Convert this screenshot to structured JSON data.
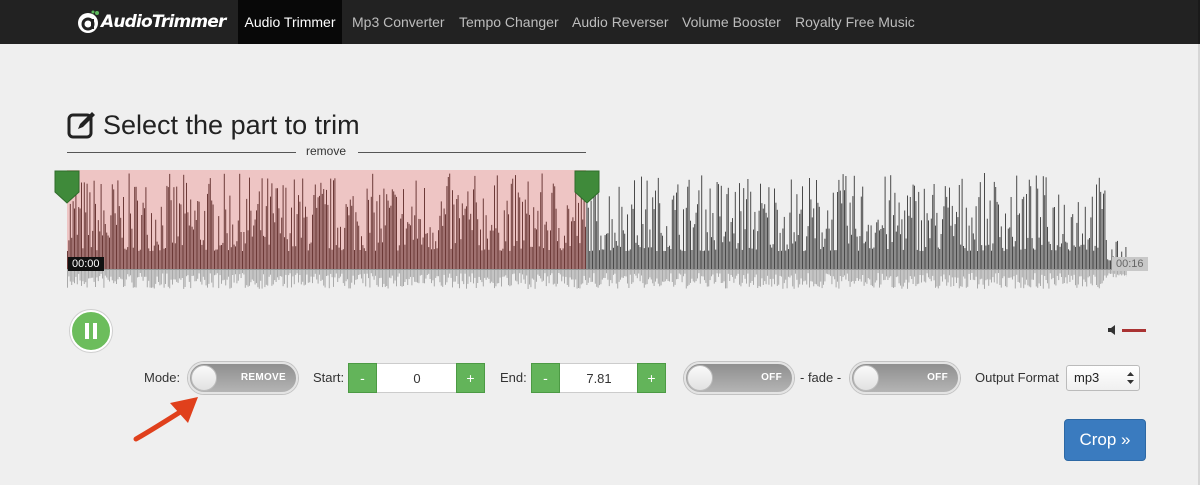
{
  "brand": {
    "name": "AudioTrimmer"
  },
  "nav": {
    "items": [
      {
        "label": "Audio Trimmer",
        "active": true
      },
      {
        "label": "Mp3 Converter"
      },
      {
        "label": "Tempo Changer"
      },
      {
        "label": "Audio Reverser"
      },
      {
        "label": "Volume Booster"
      },
      {
        "label": "Royalty Free Music"
      }
    ]
  },
  "editor": {
    "title": "Select the part to trim",
    "mode_caption": "remove",
    "time_start": "00:00",
    "time_end": "00:16",
    "selection": {
      "start_fraction": 0.49
    },
    "colors": {
      "selection": "#eec5c4",
      "wave": "#4a4a4a",
      "wave_selected": "#6d3a38",
      "handle": "#3f8a3a"
    }
  },
  "controls": {
    "mode_label": "Mode:",
    "mode_toggle": "REMOVE",
    "start_label": "Start:",
    "start_value": "0",
    "end_label": "End:",
    "end_value": "7.81",
    "minus": "-",
    "plus": "+",
    "fade_in_toggle": "OFF",
    "fade_label": "- fade -",
    "fade_out_toggle": "OFF",
    "output_label": "Output Format",
    "output_value": "mp3",
    "crop_label": "Crop »"
  }
}
